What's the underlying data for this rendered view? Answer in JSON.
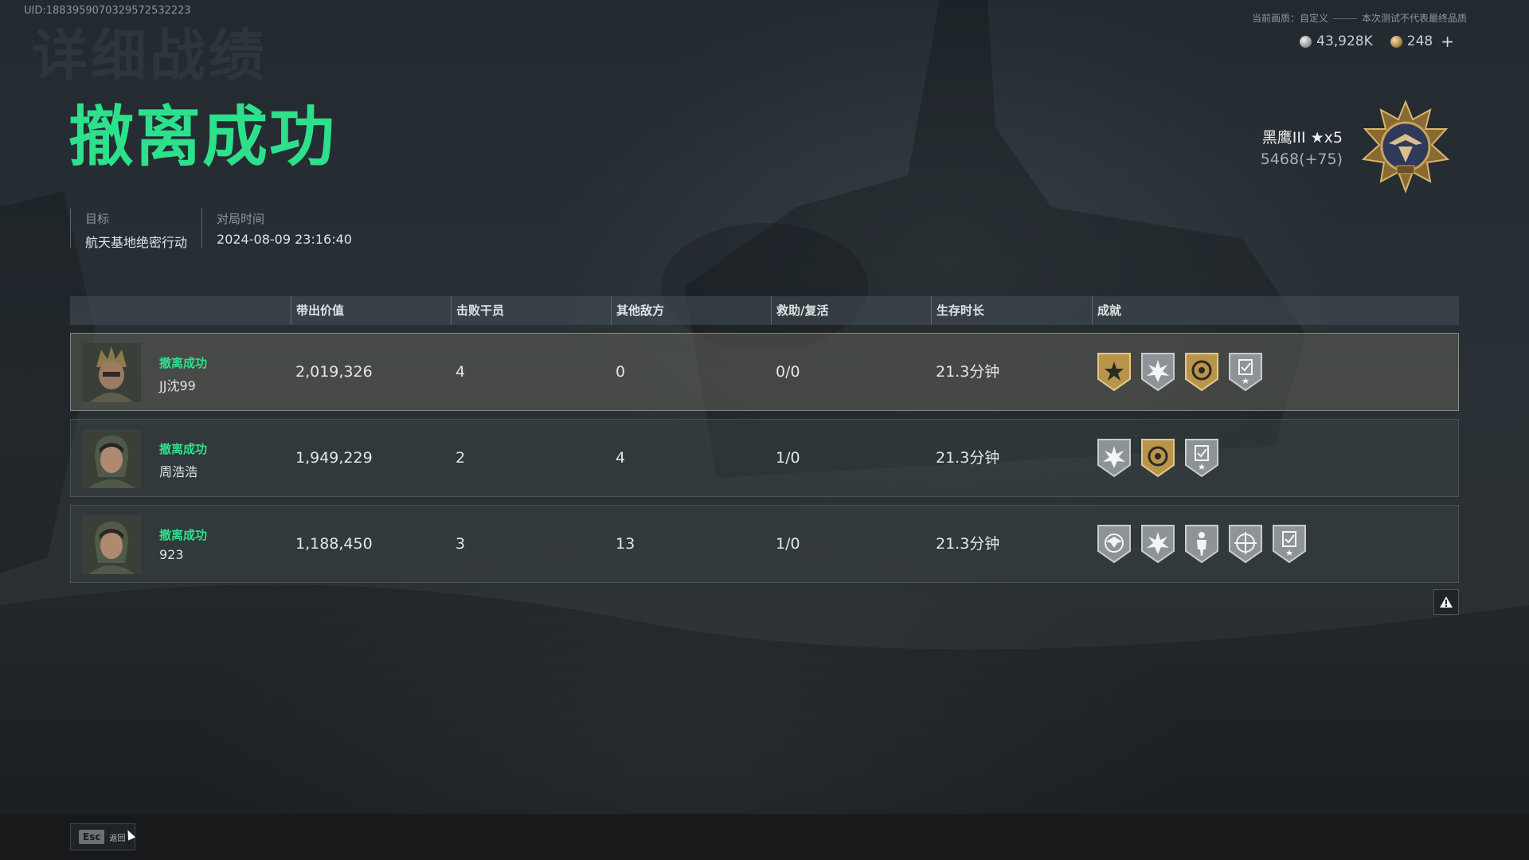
{
  "uid": "UID:1883959070329572532223",
  "ghost_title": "详细战绩",
  "top_info": {
    "quality": "当前画质：自定义",
    "disclaimer": "本次测试不代表最终品质"
  },
  "currency": {
    "silver": "43,928K",
    "gold": "248",
    "add": "+"
  },
  "result_title": "撤离成功",
  "meta": {
    "target_label": "目标",
    "target_value": "航天基地绝密行动",
    "time_label": "对局时间",
    "time_value": "2024-08-09 23:16:40"
  },
  "rank": {
    "name": "黑鹰III ★x5",
    "points": "5468(+75)"
  },
  "table": {
    "headers": [
      "带出价值",
      "击败干员",
      "其他敌方",
      "救助/复活",
      "生存时长",
      "成就"
    ],
    "rows": [
      {
        "status": "撤离成功",
        "name": "JJ沈99",
        "value": "2,019,326",
        "kills": "4",
        "other": "0",
        "assist": "0/0",
        "time": "21.3分钟",
        "badges": [
          "gold-star-badge-icon",
          "silver-burst-badge-icon",
          "gold-target-badge-icon",
          "silver-checklist-badge-icon"
        ]
      },
      {
        "status": "撤离成功",
        "name": "周浩浩",
        "value": "1,949,229",
        "kills": "2",
        "other": "4",
        "assist": "1/0",
        "time": "21.3分钟",
        "badges": [
          "silver-burst-badge-icon",
          "gold-target-badge-icon",
          "silver-checklist-badge-icon"
        ]
      },
      {
        "status": "撤离成功",
        "name": "923",
        "value": "1,188,450",
        "kills": "3",
        "other": "13",
        "assist": "1/0",
        "time": "21.3分钟",
        "badges": [
          "silver-eagle-badge-icon",
          "silver-burst-badge-icon",
          "silver-soldier-badge-icon",
          "silver-crosshair-badge-icon",
          "silver-checklist-badge-icon"
        ]
      }
    ]
  },
  "footer": {
    "esc_key": "Esc",
    "esc_label": "返回"
  },
  "colors": {
    "accent": "#2de08c",
    "gold_badge": "#b8954a",
    "silver_badge": "#8d9396"
  }
}
